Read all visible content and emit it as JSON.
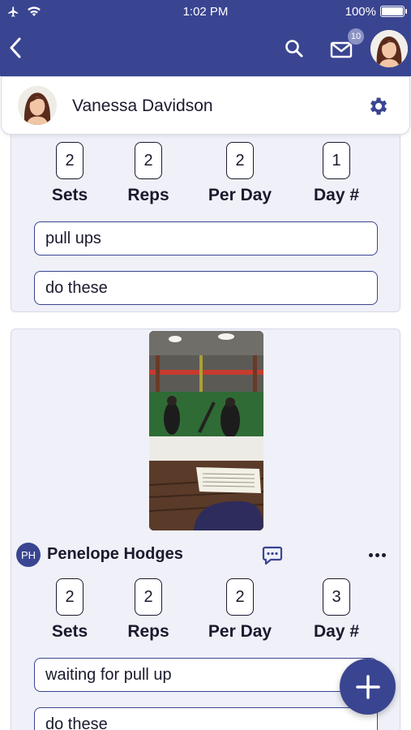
{
  "status_bar": {
    "time": "1:02 PM",
    "battery": "100%",
    "battery_level": 1.0
  },
  "header": {
    "mail_badge": "10"
  },
  "profile": {
    "name": "Vanessa Davidson"
  },
  "cards": [
    {
      "stats": [
        {
          "value": "2",
          "label": "Sets"
        },
        {
          "value": "2",
          "label": "Reps"
        },
        {
          "value": "2",
          "label": "Per Day"
        },
        {
          "value": "1",
          "label": "Day #"
        }
      ],
      "notes": [
        "pull ups",
        "do these"
      ]
    },
    {
      "author": {
        "initials": "PH",
        "name": "Penelope Hodges"
      },
      "stats": [
        {
          "value": "2",
          "label": "Sets"
        },
        {
          "value": "2",
          "label": "Reps"
        },
        {
          "value": "2",
          "label": "Per Day"
        },
        {
          "value": "3",
          "label": "Day #"
        }
      ],
      "notes": [
        "waiting for pull up",
        "do these"
      ]
    }
  ],
  "colors": {
    "primary": "#3a4591",
    "card_bg": "#eff0f8",
    "badge": "#8b92c4"
  },
  "icons": [
    "airplane-icon",
    "wifi-icon",
    "battery-icon",
    "back-arrow-icon",
    "search-icon",
    "mail-icon",
    "gear-icon",
    "comment-icon",
    "more-icon",
    "plus-icon"
  ]
}
